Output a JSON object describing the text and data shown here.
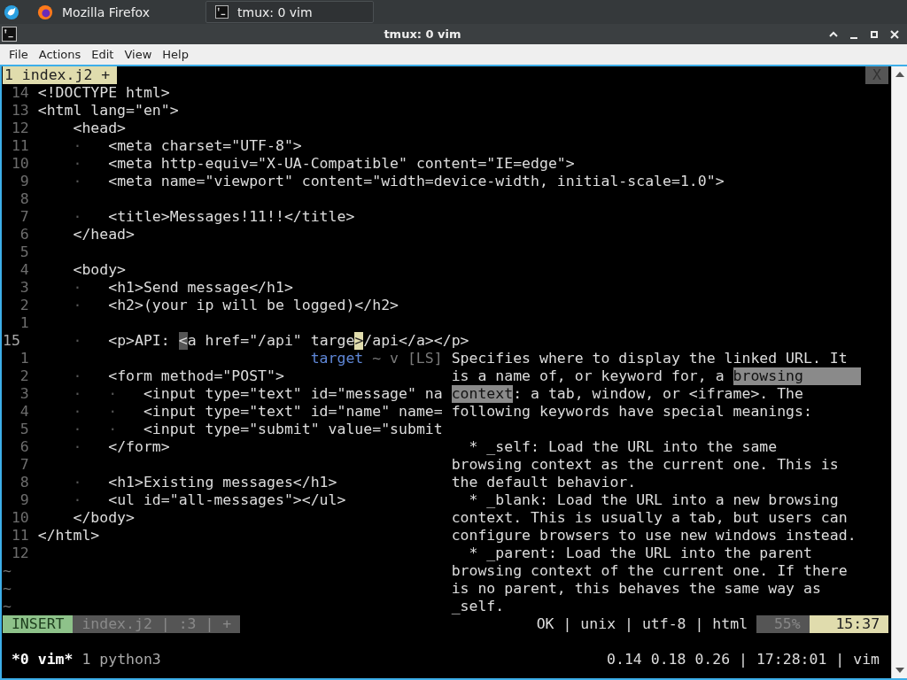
{
  "taskbar": {
    "tasks": [
      {
        "label": "Mozilla Firefox",
        "selected": false
      },
      {
        "label": "tmux: 0 vim",
        "selected": true
      }
    ]
  },
  "window": {
    "title": "tmux: 0 vim"
  },
  "menu": [
    "File",
    "Actions",
    "Edit",
    "View",
    "Help"
  ],
  "vim": {
    "tab": {
      "label": "1 index.j2 +",
      "close": "X"
    },
    "lines": [
      {
        "number": "14",
        "code": "<!DOCTYPE html>"
      },
      {
        "number": "13",
        "code": "<html lang=\"en\">"
      },
      {
        "number": "12",
        "code": "    <head>"
      },
      {
        "number": "11",
        "indent": "    ·   ",
        "code": "<meta charset=\"UTF-8\">"
      },
      {
        "number": "10",
        "indent": "    ·   ",
        "code": "<meta http-equiv=\"X-UA-Compatible\" content=\"IE=edge\">"
      },
      {
        "number": "9",
        "indent": "    ·   ",
        "code": "<meta name=\"viewport\" content=\"width=device-width, initial-scale=1.0\">"
      },
      {
        "number": "8"
      },
      {
        "number": "7",
        "indent": "    ·   ",
        "code": "<title>Messages!11!!</title>"
      },
      {
        "number": "6",
        "code": "    </head>"
      },
      {
        "number": "5"
      },
      {
        "number": "4",
        "code": "    <body>"
      },
      {
        "number": "3",
        "indent": "    ·   ",
        "code": "<h1>Send message</h1>"
      },
      {
        "number": "2",
        "indent": "    ·   ",
        "code": "<h2>(your ip will be logged)</h2>"
      },
      {
        "number": "1"
      },
      {
        "number": "15",
        "current": true,
        "indent": "    ·   ",
        "parts": [
          {
            "text": "<p>API: ",
            "kind": "plain"
          },
          {
            "text": "<",
            "kind": "match"
          },
          {
            "text": "a href=\"/api\" targe",
            "kind": "plain"
          },
          {
            "text": ">",
            "kind": "cursor"
          },
          {
            "text": "/api</a></p>",
            "kind": "plain"
          }
        ]
      },
      {
        "number": "1",
        "completion": {
          "word": "target",
          "menu": "~ v",
          "source": "[LS]"
        }
      },
      {
        "number": "2",
        "indent": "    ·   ",
        "code": "<form method=\"POST\">"
      },
      {
        "number": "3",
        "indent": "    ·   ·   ",
        "code": "<input type=\"text\" id=\"message\" na"
      },
      {
        "number": "4",
        "indent": "    ·   ·   ",
        "code": "<input type=\"text\" id=\"name\" name="
      },
      {
        "number": "5",
        "indent": "    ·   ·   ",
        "code": "<input type=\"submit\" value=\"submit"
      },
      {
        "number": "6",
        "indent": "    ·   ",
        "code": "</form>"
      },
      {
        "number": "7"
      },
      {
        "number": "8",
        "indent": "    ·   ",
        "code": "<h1>Existing messages</h1>"
      },
      {
        "number": "9",
        "indent": "    ·   ",
        "code": "<ul id=\"all-messages\"></ul>"
      },
      {
        "number": "10",
        "code": "    </body>"
      },
      {
        "number": "11",
        "code": "</html>"
      },
      {
        "number": "12"
      }
    ],
    "filler": [
      "~",
      "~",
      "~"
    ],
    "doc": [
      {
        "segments": [
          {
            "text": "Specifies where to display the linked URL. It",
            "highlight": false
          }
        ]
      },
      {
        "segments": [
          {
            "text": "is a name of, or keyword for, a ",
            "highlight": false
          },
          {
            "text": "browsing",
            "highlight": true
          }
        ]
      },
      {
        "segments": [
          {
            "text": "context",
            "highlight": true
          },
          {
            "text": ": a tab, window, or <iframe>. The",
            "highlight": false
          }
        ]
      },
      {
        "segments": [
          {
            "text": "following keywords have special meanings:",
            "highlight": false
          }
        ]
      },
      {
        "spaced": true,
        "segments": [
          {
            "text": "  * _self: Load the URL into the same",
            "highlight": false
          }
        ]
      },
      {
        "segments": [
          {
            "text": "browsing context as the current one. This is",
            "highlight": false
          }
        ]
      },
      {
        "segments": [
          {
            "text": "the default behavior.",
            "highlight": false
          }
        ]
      },
      {
        "segments": [
          {
            "text": "  * _blank: Load the URL into a new browsing",
            "highlight": false
          }
        ]
      },
      {
        "segments": [
          {
            "text": "context. This is usually a tab, but users can",
            "highlight": false
          }
        ]
      },
      {
        "segments": [
          {
            "text": "configure browsers to use new windows instead.",
            "highlight": false
          }
        ]
      },
      {
        "segments": [
          {
            "text": "  * _parent: Load the URL into the parent",
            "highlight": false
          }
        ]
      },
      {
        "segments": [
          {
            "text": "browsing context of the current one. If there",
            "highlight": false
          }
        ]
      },
      {
        "segments": [
          {
            "text": "is no parent, this behaves the same way as",
            "highlight": false
          }
        ]
      },
      {
        "segments": [
          {
            "text": "_self.",
            "highlight": false
          }
        ]
      }
    ],
    "statusline": {
      "mode": "INSERT",
      "file": "index.j2 | :3 | +",
      "info": "OK | unix | utf-8 | html",
      "percent": "55%",
      "position": "15:37"
    }
  },
  "tmux": {
    "windows": [
      {
        "label": "*0 vim*",
        "selected": true
      },
      {
        "label": "1 python3",
        "selected": false
      }
    ],
    "right": "0.14 0.18 0.26 | 17:28:01 | vim"
  }
}
